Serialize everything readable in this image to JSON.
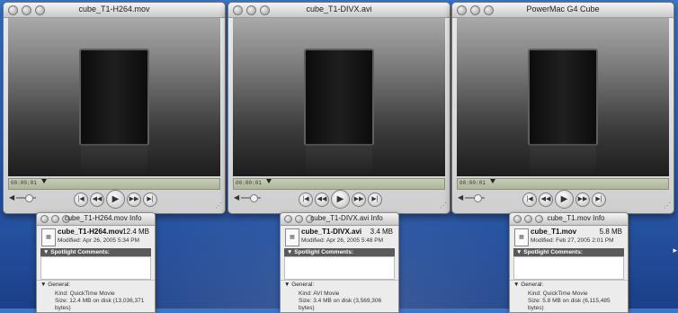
{
  "players": [
    {
      "title": "cube_T1-H264.mov",
      "timecode": "00:00:01"
    },
    {
      "title": "cube_T1-DIVX.avi",
      "timecode": "00:00:01"
    },
    {
      "title": "PowerMac G4 Cube",
      "timecode": "00:00:01"
    }
  ],
  "controls": {
    "volume_icon": "◀",
    "rewind_end": "|◀",
    "rewind": "◀◀",
    "play": "▶",
    "fast_forward": "▶▶",
    "forward_end": "▶|"
  },
  "info_windows": [
    {
      "title": "cube_T1-H264.mov Info",
      "name": "cube_T1-H264.mov",
      "size": "12.4 MB",
      "modified": "Modified: Apr 26, 2005 5:34 PM",
      "spotlight": "Spotlight Comments:",
      "general": "General:",
      "kind": "Kind: QuickTime Movie",
      "size_detail": "Size: 12.4 MB on disk (13,036,371 bytes)"
    },
    {
      "title": "cube_T1-DIVX.avi Info",
      "name": "cube_T1-DIVX.avi",
      "size": "3.4 MB",
      "modified": "Modified: Apr 26, 2005 5:48 PM",
      "spotlight": "Spotlight Comments:",
      "general": "General:",
      "kind": "Kind: AVI Movie",
      "size_detail": "Size: 3.4 MB on disk (3,569,306 bytes)"
    },
    {
      "title": "cube_T1.mov Info",
      "name": "cube_T1.mov",
      "size": "5.8 MB",
      "modified": "Modified: Feb 27, 2005 2:01 PM",
      "spotlight": "Spotlight Comments:",
      "general": "General:",
      "kind": "Kind: QuickTime Movie",
      "size_detail": "Size: 5.8 MB on disk (6,115,485 bytes)"
    }
  ]
}
